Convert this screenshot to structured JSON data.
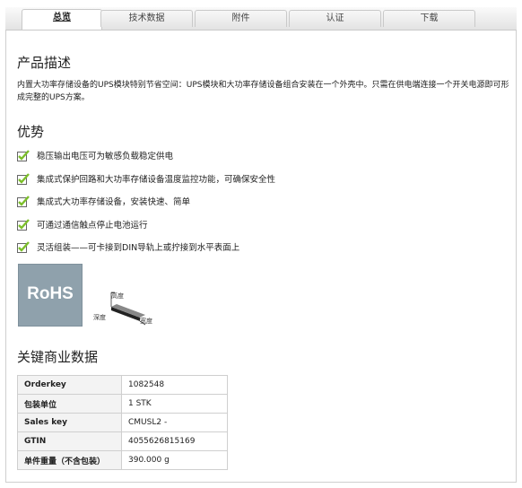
{
  "tabs": [
    {
      "label": "总览"
    },
    {
      "label": "技术数据"
    },
    {
      "label": "附件"
    },
    {
      "label": "认证"
    },
    {
      "label": "下载"
    }
  ],
  "description": {
    "title": "产品描述",
    "text": "内置大功率存储设备的UPS模块特别节省空间：UPS模块和大功率存储设备组合安装在一个外壳中。只需在供电端连接一个开关电源即可形成完整的UPS方案。"
  },
  "advantages": {
    "title": "优势",
    "items": [
      "稳压输出电压可为敏感负载稳定供电",
      "集成式保护回路和大功率存储设备温度监控功能，可确保安全性",
      "集成式大功率存储设备，安装快速、简单",
      "可通过通信触点停止电池运行",
      "灵活组装——可卡接到DIN导轨上或拧接到水平表面上"
    ]
  },
  "rohs": {
    "label": "RoHS"
  },
  "dimensions": {
    "height": "高度",
    "depth": "深度",
    "width": "宽度"
  },
  "business": {
    "title": "关键商业数据",
    "rows": [
      {
        "key": "Orderkey",
        "value": "1082548"
      },
      {
        "key": "包装单位",
        "value": "1 STK"
      },
      {
        "key": "Sales key",
        "value": "CMUSL2 -"
      },
      {
        "key": "GTIN",
        "value": "4055626815169"
      },
      {
        "key": "单件重量（不含包装）",
        "value": "390.000 g"
      }
    ]
  },
  "colors": {
    "check": "#7cbf2a",
    "rohs_bg": "#8fa1ac",
    "tab_border": "#c9c9c9"
  }
}
